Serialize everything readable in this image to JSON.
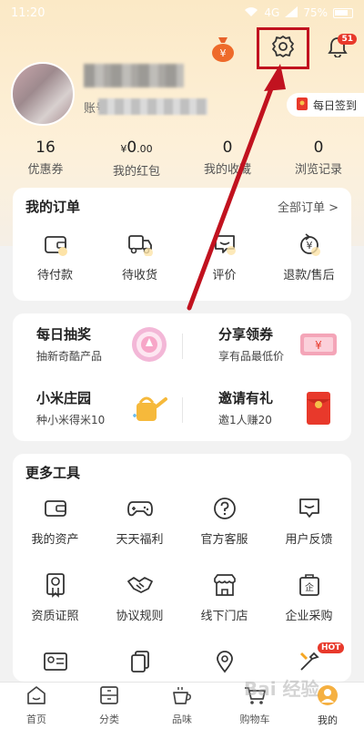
{
  "status": {
    "time": "11:20",
    "signal": "4G",
    "battery": "75%"
  },
  "header": {
    "notification_count": "51",
    "signin_label": "每日签到"
  },
  "profile": {
    "account_prefix": "账号"
  },
  "stats": [
    {
      "num": "16",
      "label": "优惠券"
    },
    {
      "num_prefix": "¥",
      "num": "0",
      "num_suffix": ".00",
      "label": "我的红包"
    },
    {
      "num": "0",
      "label": "我的收藏"
    },
    {
      "num": "0",
      "label": "浏览记录"
    }
  ],
  "orders": {
    "title": "我的订单",
    "all_label": "全部订单 >",
    "items": [
      "待付款",
      "待收货",
      "评价",
      "退款/售后"
    ]
  },
  "promo": [
    {
      "title": "每日抽奖",
      "sub": "抽新奇酷产品"
    },
    {
      "title": "分享领券",
      "sub": "享有品最低价"
    },
    {
      "title": "小米庄园",
      "sub": "种小米得米10"
    },
    {
      "title": "邀请有礼",
      "sub": "邀1人赚20"
    }
  ],
  "tools": {
    "title": "更多工具",
    "items": [
      "我的资产",
      "天天福利",
      "官方客服",
      "用户反馈",
      "资质证照",
      "协议规则",
      "线下门店",
      "企业采购"
    ],
    "hot_label": "HOT"
  },
  "tabs": [
    "首页",
    "分类",
    "品味",
    "购物车",
    "我的"
  ],
  "watermark": "Bai 经验",
  "colors": {
    "accent": "#c1121f",
    "badge": "#e8392b",
    "header_bg": "#fbe9c6"
  }
}
